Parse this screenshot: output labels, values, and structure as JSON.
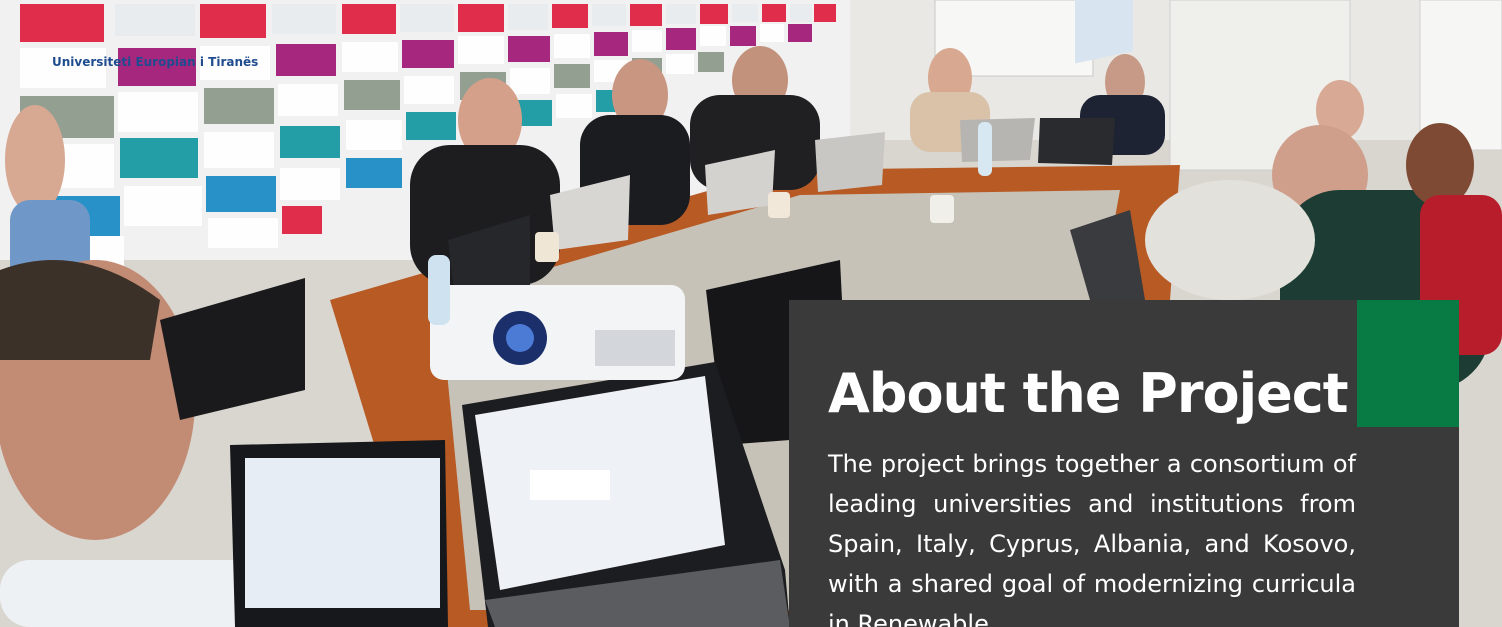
{
  "colors": {
    "card_background": "#3a3a3a",
    "accent": "#087a44",
    "text": "#ffffff"
  },
  "photo": {
    "wall_text": "Universiteti Europian i Tiranës"
  },
  "about": {
    "title": "About the Project",
    "body": "The project brings together a consortium of leading universities and institutions from Spain, Italy, Cyprus, Albania, and Kosovo, with a shared goal of modernizing curricula in Renewable"
  }
}
